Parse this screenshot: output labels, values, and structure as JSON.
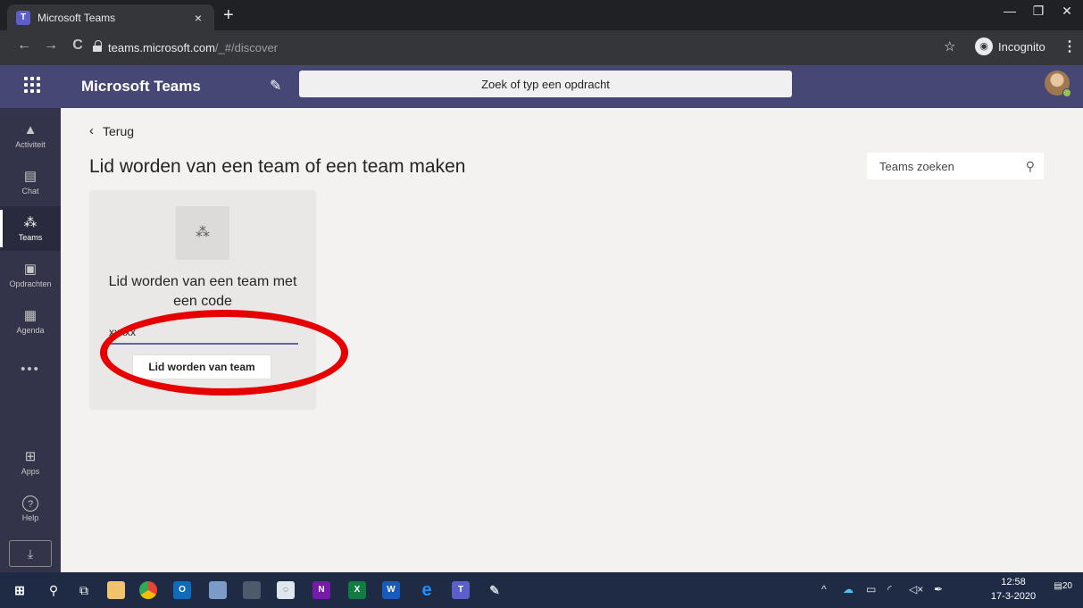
{
  "browser": {
    "tab_title": "Microsoft Teams",
    "tab_favicon": "T",
    "tab_close": "×",
    "new_tab": "+",
    "minimize": "—",
    "restore": "❐",
    "close": "✕",
    "back": "←",
    "forward": "→",
    "reload": "C",
    "url_host": "teams.microsoft.com",
    "url_path": "/_#/discover",
    "star": "☆",
    "incognito_label": "Incognito",
    "menu": "⋮"
  },
  "teams_header": {
    "app_title": "Microsoft Teams",
    "compose_icon": "✎",
    "search_placeholder": "Zoek of typ een opdracht"
  },
  "rail": {
    "items": [
      {
        "label": "Activiteit",
        "icon": "bell-icon",
        "glyph": "🔔"
      },
      {
        "label": "Chat",
        "icon": "chat-icon",
        "glyph": "▤"
      },
      {
        "label": "Teams",
        "icon": "teams-icon",
        "glyph": "⁂"
      },
      {
        "label": "Opdrachten",
        "icon": "assignments-icon",
        "glyph": "▣"
      },
      {
        "label": "Agenda",
        "icon": "calendar-icon",
        "glyph": "▦"
      }
    ],
    "more": "•••",
    "bottom_items": [
      {
        "label": "Apps",
        "icon": "apps-icon",
        "glyph": "⊞"
      },
      {
        "label": "Help",
        "icon": "help-icon",
        "glyph": "?"
      }
    ],
    "download_glyph": "⤓"
  },
  "main": {
    "back_label": "Terug",
    "back_chevron": "‹",
    "page_title": "Lid worden van een team of een team maken",
    "team_search_placeholder": "Teams zoeken",
    "search_glyph": "⚲",
    "card": {
      "tile_glyph": "⁂",
      "heading": "Lid worden van een team met een code",
      "code_value": "xxxxx",
      "join_button_label": "Lid worden van team"
    }
  },
  "taskbar": {
    "time": "12:58",
    "date": "17-3-2020",
    "notifications": "20"
  }
}
